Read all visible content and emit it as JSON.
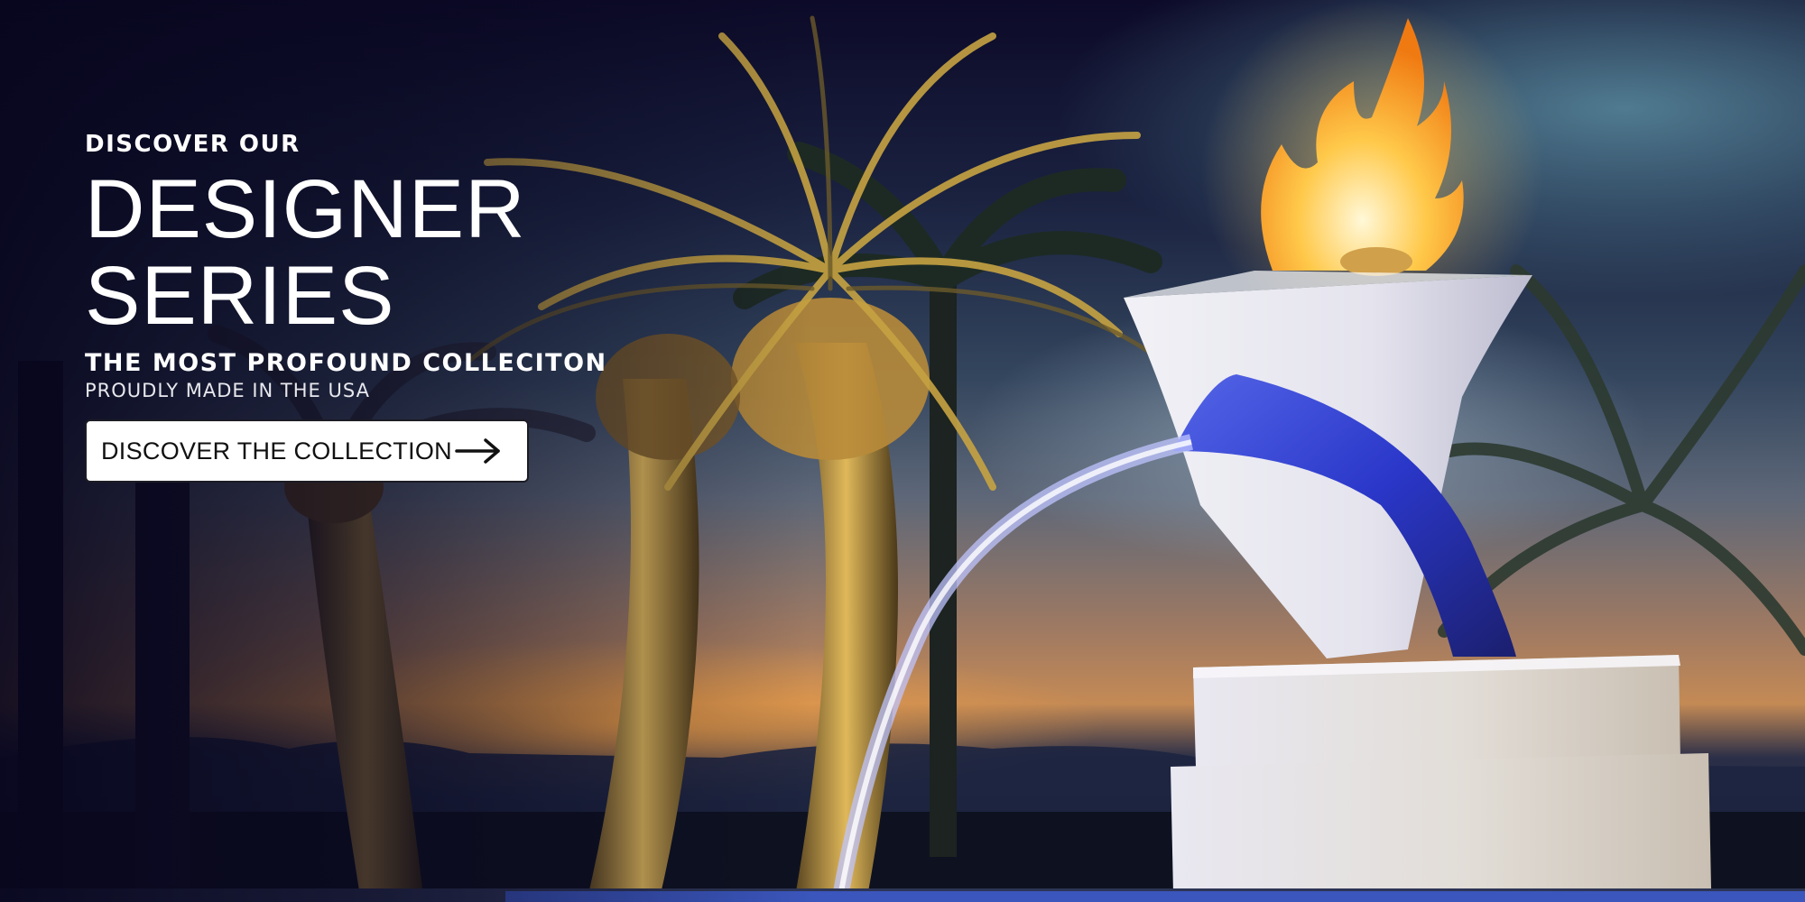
{
  "hero": {
    "eyebrow": "DISCOVER OUR",
    "headline_line1": "DESIGNER",
    "headline_line2": "SERIES",
    "tagline": "THE MOST PROFOUND COLLECITON",
    "subline": "PROUDLY MADE IN THE USA",
    "cta_label": "DISCOVER THE COLLECTION",
    "cta_icon": "arrow-right-icon"
  },
  "colors": {
    "text": "#ffffff",
    "cta_background": "#ffffff",
    "cta_text": "#111111",
    "water_accent": "#2d3fd0"
  }
}
